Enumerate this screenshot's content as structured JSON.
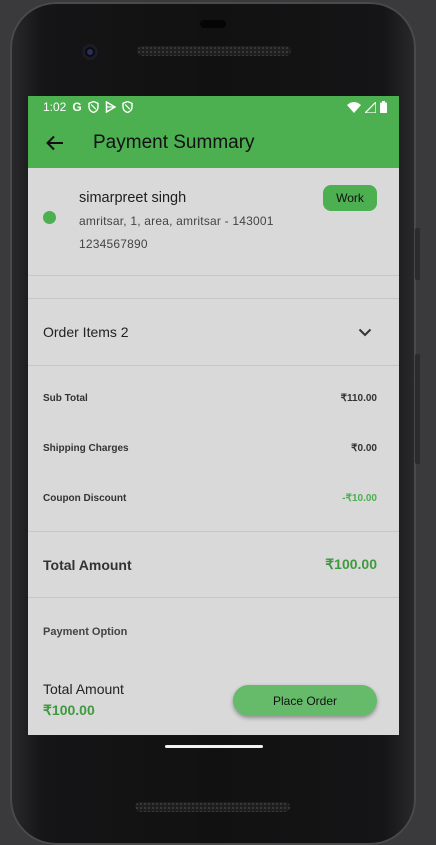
{
  "status_bar": {
    "time": "1:02",
    "icons_left": [
      "google-icon",
      "shield-icon",
      "play-store-icon",
      "shield-icon"
    ],
    "icons_right": [
      "wifi-icon",
      "signal-icon",
      "battery-icon"
    ]
  },
  "app_bar": {
    "back_icon": "arrow-back-icon",
    "title": "Payment Summary",
    "color": "#4caf50"
  },
  "address": {
    "name": "simarpreet singh",
    "line": "amritsar, 1, area, amritsar - 143001",
    "phone": "1234567890",
    "tag": "Work",
    "selected": true
  },
  "order_items": {
    "label": "Order Items 2",
    "icon": "chevron-down-icon"
  },
  "summary": {
    "rows": [
      {
        "label": "Sub Total",
        "value": "₹110.00"
      },
      {
        "label": "Shipping Charges",
        "value": "₹0.00"
      },
      {
        "label": "Coupon Discount",
        "value": "-₹10.00"
      }
    ]
  },
  "total": {
    "label": "Total Amount",
    "value": "₹100.00"
  },
  "payment_option": {
    "label": "Payment Option"
  },
  "footer": {
    "label": "Total Amount",
    "value": "₹100.00",
    "button": "Place Order"
  }
}
